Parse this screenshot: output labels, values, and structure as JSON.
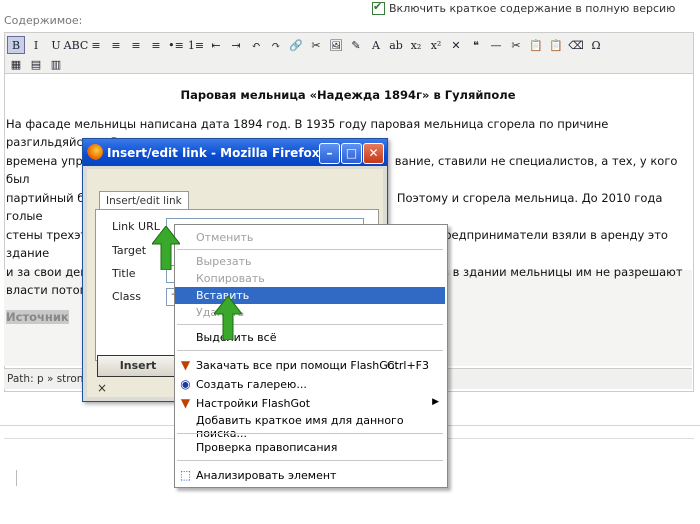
{
  "top": {
    "content_label": "Содержимое:",
    "include_checkbox_label": "Включить краткое содержание в полную версию"
  },
  "toolbar": {
    "row1": [
      "B",
      "I",
      "U",
      "ABC",
      "≡",
      "≡",
      "≡",
      "≡",
      "•≡",
      "1≡",
      "⇤",
      "⇥",
      "↶",
      "↷",
      "🔗",
      "✂",
      "🖼",
      "✎",
      "A",
      "ab",
      "x₂",
      "x²",
      "✕",
      "❝",
      "—",
      "✂",
      "📋",
      "📋",
      "⌫",
      "Ω"
    ],
    "row2": [
      "▦",
      "▤",
      "▥"
    ]
  },
  "document": {
    "title": "Паровая мельница «Надежда 1894г» в Гуляйполе",
    "line1": "На фасаде мельницы написана дата 1894 год. В 1935 году паровая мельница сгорела по причине разгильдяйства. В те",
    "line2a": "времена упра",
    "line2b": "вание, ставили не специалистов, а тех, у кого был",
    "line3a": "партийный би",
    "line3b": "Поэтому и сгорела мельница. До 2010 года голые",
    "line4a": "стены трехэта",
    "line4b": "естные предприниматели взяли в аренду это здание",
    "line5a": "и за свои ден",
    "line5b": "врировать в здании мельницы им не разрешают",
    "line6a": "власти потом",
    "source": "Источник"
  },
  "statusbar": {
    "path": "Path: p » strong"
  },
  "dialog": {
    "title": "Insert/edit link - Mozilla Firefox",
    "tab": "Insert/edit link",
    "link_url_label": "Link URL",
    "target_label": "Target",
    "title_label": "Title",
    "class_label": "Class",
    "class_value": "-",
    "insert_button": "Insert",
    "close_glyph": "×"
  },
  "context_menu": {
    "items": [
      {
        "label": "Отменить",
        "disabled": true
      },
      {
        "label": "Вырезать",
        "disabled": true
      },
      {
        "label": "Копировать",
        "disabled": true
      },
      {
        "label": "Вставить",
        "highlighted": true
      },
      {
        "label": "Удалить",
        "disabled": true
      },
      {
        "label": "Выделить всё"
      },
      {
        "label": "Закачать все при помощи FlashGot",
        "shortcut": "Ctrl+F3"
      },
      {
        "label": "Создать галерею..."
      },
      {
        "label": "Настройки FlashGot",
        "submenu": true
      },
      {
        "label": "Добавить краткое имя для данного поиска..."
      },
      {
        "label": "Проверка правописания"
      },
      {
        "label": "Анализировать элемент"
      }
    ]
  },
  "colors": {
    "titlebar": "#0a4bd0",
    "menu_highlight": "#316ac5",
    "arrow_green": "#3aa82a"
  }
}
